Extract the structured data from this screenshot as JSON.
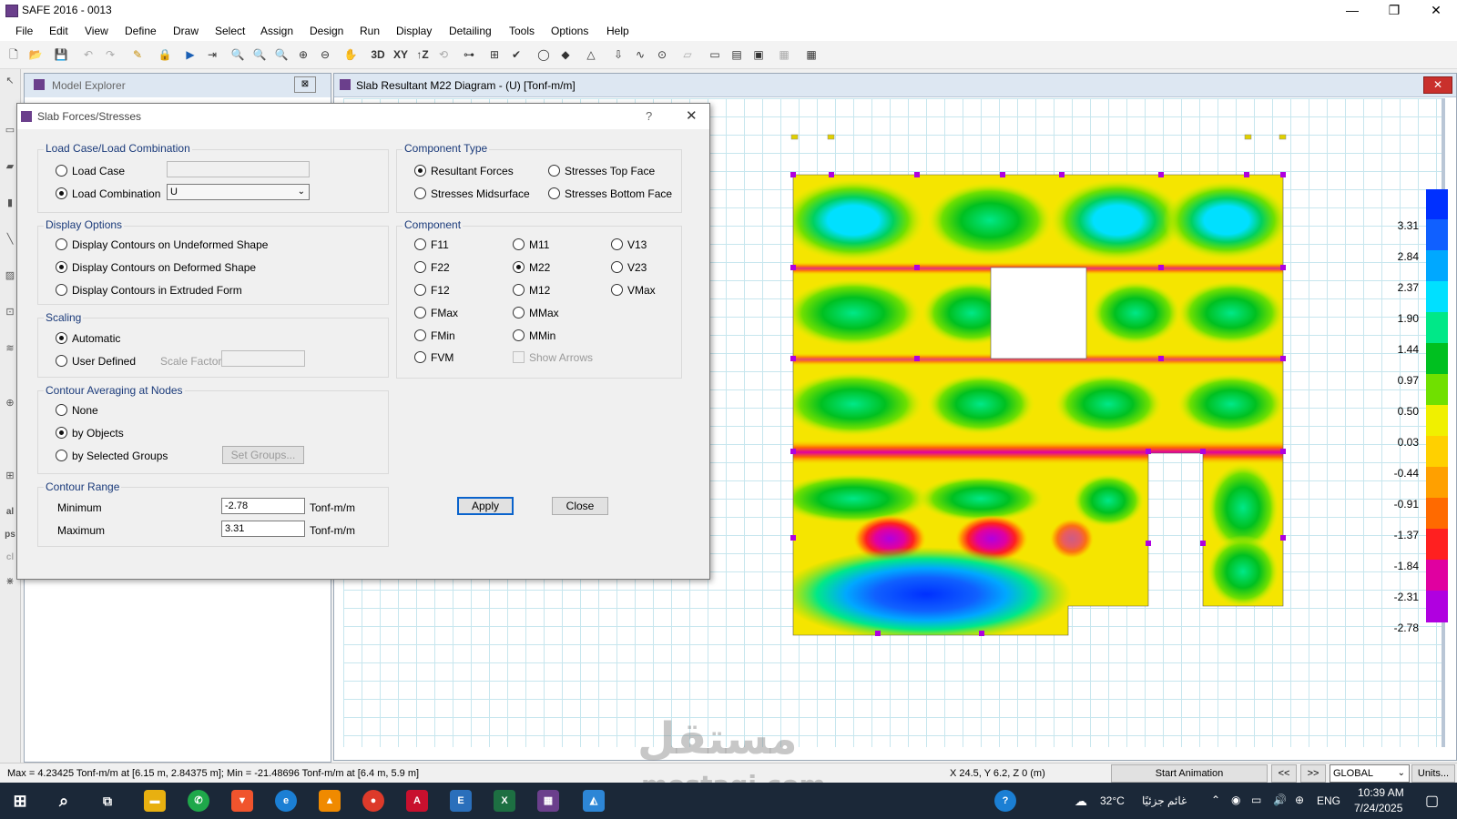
{
  "window": {
    "title": "SAFE 2016 - 0013",
    "minimize": "—",
    "maximize": "❐",
    "close": "✕"
  },
  "menu": [
    "File",
    "Edit",
    "View",
    "Define",
    "Draw",
    "Select",
    "Assign",
    "Design",
    "Run",
    "Display",
    "Detailing",
    "Tools",
    "Options",
    "Help"
  ],
  "toolbar": {
    "btn_3d": "3D",
    "btn_xy": "XY",
    "btn_tz": "↑Z"
  },
  "explorer": {
    "title": "Model Explorer",
    "close": "⊠"
  },
  "view": {
    "title": "Slab Resultant M22 Diagram - (U)  [Tonf-m/m]",
    "close": "✕"
  },
  "legend": {
    "labels": [
      "3.31",
      "2.84",
      "2.37",
      "1.90",
      "1.44",
      "0.97",
      "0.50",
      "0.03",
      "-0.44",
      "-0.91",
      "-1.37",
      "-1.84",
      "-2.31",
      "-2.78"
    ],
    "colors": [
      "#0030ff",
      "#1060ff",
      "#00a8ff",
      "#00e0ff",
      "#00e888",
      "#00c020",
      "#70e000",
      "#f0f000",
      "#ffd000",
      "#ffa000",
      "#ff6a00",
      "#ff2020",
      "#e000a0",
      "#b000e0"
    ]
  },
  "dialog": {
    "title": "Slab Forces/Stresses",
    "help": "?",
    "close": "✕",
    "load_case_group": "Load Case/Load Combination",
    "load_case": "Load Case",
    "load_combination": "Load Combination",
    "combination_value": "U",
    "component_type_group": "Component Type",
    "resultant_forces": "Resultant Forces",
    "stresses_top_face": "Stresses Top Face",
    "stresses_midsurface": "Stresses Midsurface",
    "stresses_bottom_face": "Stresses Bottom Face",
    "display_options_group": "Display Options",
    "display_undeformed": "Display Contours on Undeformed Shape",
    "display_deformed": "Display Contours on Deformed Shape",
    "display_extruded": "Display Contours in Extruded Form",
    "component_group": "Component",
    "components": [
      "F11",
      "M11",
      "V13",
      "F22",
      "M22",
      "V23",
      "F12",
      "M12",
      "VMax",
      "FMax",
      "MMax",
      "FMin",
      "MMin",
      "FVM"
    ],
    "show_arrows": "Show Arrows",
    "scaling_group": "Scaling",
    "automatic": "Automatic",
    "user_defined": "User Defined",
    "scale_factor": "Scale Factor",
    "averaging_group": "Contour Averaging at Nodes",
    "avg_none": "None",
    "avg_by_objects": "by Objects",
    "avg_by_groups": "by Selected Groups",
    "set_groups": "Set Groups...",
    "range_group": "Contour Range",
    "minimum": "Minimum",
    "maximum": "Maximum",
    "min_value": "-2.78",
    "max_value": "3.31",
    "unit": "Tonf-m/m",
    "apply": "Apply",
    "close_button": "Close"
  },
  "statusbar": {
    "maxmin": "Max = 4.23425 Tonf-m/m at [6.15 m, 2.84375 m];  Min = -21.48696 Tonf-m/m at [6.4 m, 5.9 m]",
    "coords": "X 24.5,  Y 6.2,  Z 0  (m)",
    "start_animation": "Start Animation",
    "prev": "<<",
    "next": ">>",
    "coord_system": "GLOBAL",
    "units": "Units..."
  },
  "taskbar": {
    "weather": "32°C",
    "weather_text": "غائم جزئيًا",
    "lang": "ENG",
    "time": "10:39 AM",
    "date": "7/24/2025"
  },
  "watermark": {
    "arabic": "مستقل",
    "latin": "mostaqi.com"
  }
}
